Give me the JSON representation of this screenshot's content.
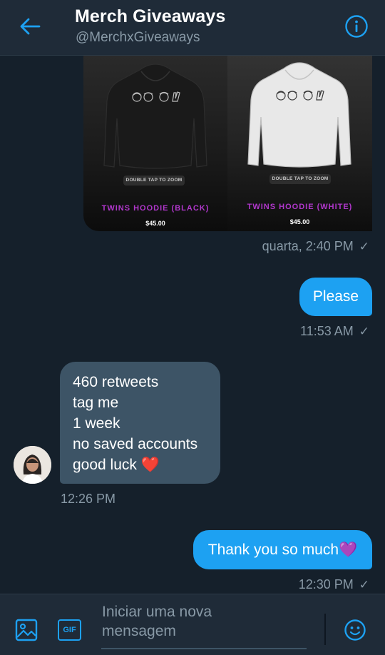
{
  "header": {
    "title": "Merch Giveaways",
    "handle": "@MerchxGiveaways",
    "back_icon": "arrow-left-icon",
    "info_icon": "info-circle-icon",
    "accent_color": "#1da1f2"
  },
  "product_image": {
    "products": [
      {
        "zoom_hint": "DOUBLE TAP TO ZOOM",
        "name": "TWINS HOODIE (BLACK)",
        "price": "$45.00"
      },
      {
        "zoom_hint": "DOUBLE TAP TO ZOOM",
        "name": "TWINS HOODIE (WHITE)",
        "price": "$45.00"
      }
    ],
    "timestamp": "quarta, 2:40 PM"
  },
  "messages": [
    {
      "direction": "outgoing",
      "text": "Please",
      "timestamp": "11:53 AM"
    },
    {
      "direction": "incoming",
      "lines": [
        "460 retweets",
        "tag me",
        "1 week",
        "no saved accounts",
        "good luck"
      ],
      "emoji": "❤️",
      "timestamp": "12:26 PM"
    },
    {
      "direction": "outgoing",
      "text": "Thank you so much",
      "emoji": "💜",
      "timestamp": "12:30 PM"
    }
  ],
  "composer": {
    "placeholder": "Iniciar uma nova mensagem",
    "image_icon": "image-icon",
    "gif_label": "GIF",
    "emoji_icon": "smiley-icon"
  },
  "colors": {
    "background": "#15202b",
    "bar": "#1f2b38",
    "outgoing_bubble": "#1da1f2",
    "incoming_bubble": "#3d5466",
    "secondary_text": "#8899a6",
    "product_label": "#b137cc"
  }
}
